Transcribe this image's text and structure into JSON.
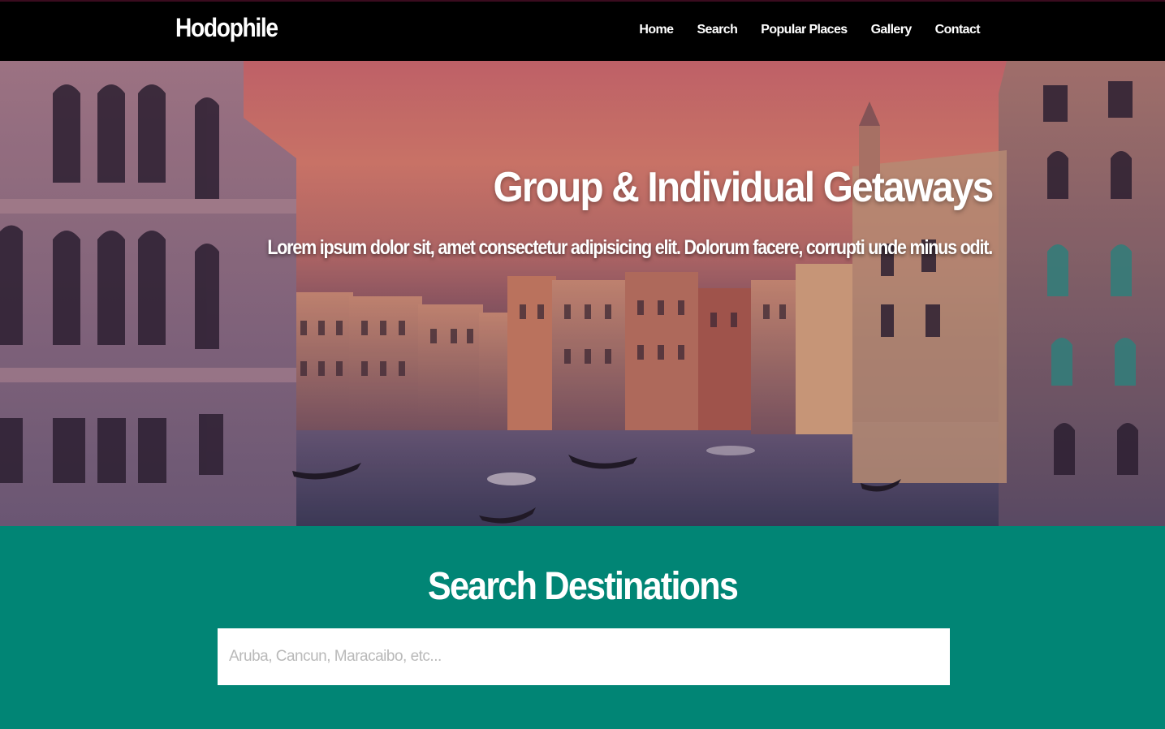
{
  "navbar": {
    "brand": "Hodophile",
    "links": [
      "Home",
      "Search",
      "Popular Places",
      "Gallery",
      "Contact"
    ]
  },
  "hero": {
    "title": "Group & Individual Getaways",
    "subtitle": "Lorem ipsum dolor sit, amet consectetur adipisicing elit. Dolorum facere, corrupti unde minus odit."
  },
  "search": {
    "heading": "Search Destinations",
    "placeholder": "Aruba, Cancun, Maracaibo, etc...",
    "value": ""
  },
  "colors": {
    "navbar_bg": "#000000",
    "search_section_bg": "#018575",
    "text": "#ffffff"
  }
}
